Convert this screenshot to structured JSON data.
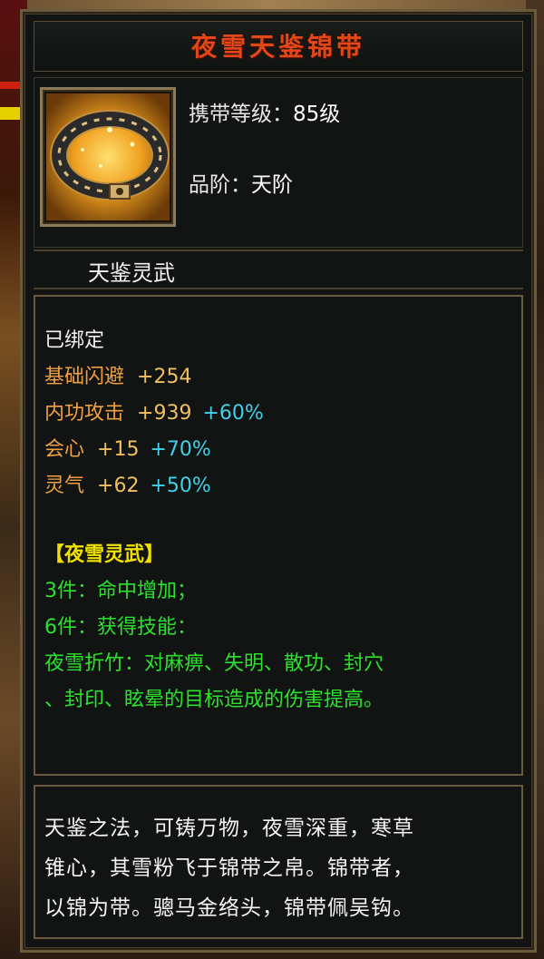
{
  "item": {
    "name": "夜雪天鉴锦带",
    "icon": "belt-icon",
    "level_label": "携带等级：",
    "level_value": "85级",
    "grade_label": "品阶：",
    "grade_value": "天阶",
    "subtitle": "天鉴灵武"
  },
  "stats": {
    "bound": "已绑定",
    "rows": [
      {
        "name": "基础闪避",
        "value": "+254",
        "pct": "",
        "name_color": "#f0a040"
      },
      {
        "name": "内功攻击",
        "value": "+939",
        "pct": "+60%",
        "name_color": "#f0a040"
      },
      {
        "name": "会心",
        "value": "+15",
        "pct": "+70%",
        "name_color": "#f0a040"
      },
      {
        "name": "灵气",
        "value": "+62",
        "pct": "+50%",
        "name_color": "#f0a040"
      }
    ]
  },
  "set": {
    "name": "【夜雪灵武】",
    "bonus3": "3件：命中增加；",
    "bonus6": "6件：获得技能：",
    "skill_line1": "夜雪折竹：对麻痹、失明、散功、封穴",
    "skill_line2": "、封印、眩晕的目标造成的伤害提高。"
  },
  "description": {
    "line1": "天鉴之法，可铸万物，夜雪深重，寒草",
    "line2": "锥心，其雪粉飞于锦带之帛。锦带者，",
    "line3": "以锦为带。骢马金络头，锦带佩吴钩。"
  }
}
